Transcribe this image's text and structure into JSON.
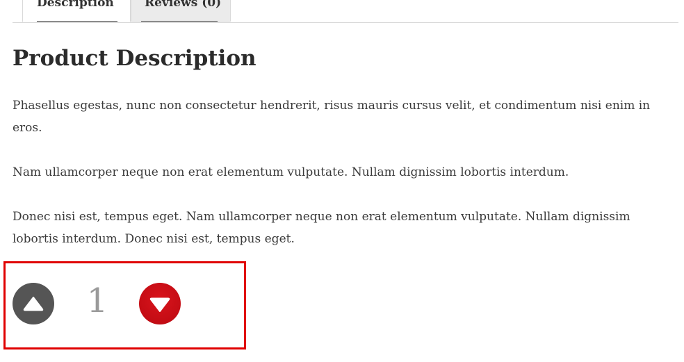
{
  "tabs": [
    {
      "label": "Description",
      "active": true
    },
    {
      "label": "Reviews (0)",
      "active": false
    }
  ],
  "main": {
    "title": "Product Description",
    "paragraphs": [
      "Phasellus egestas, nunc non consectetur hendrerit, risus mauris cursus velit, et condimentum nisi enim in eros.",
      "Nam ullamcorper neque non erat elementum vulputate. Nullam dignissim lobortis interdum.",
      "Donec nisi est, tempus eget. Nam ullamcorper neque non erat elementum vulputate. Nullam dignissim lobortis interdum. Donec nisi est, tempus eget."
    ]
  },
  "vote": {
    "count": "1",
    "up_icon": "triangle-up-icon",
    "down_icon": "triangle-down-icon",
    "colors": {
      "up": "#555555",
      "down": "#c40c14",
      "count": "#9a9a9a",
      "highlight": "#e00000"
    }
  }
}
